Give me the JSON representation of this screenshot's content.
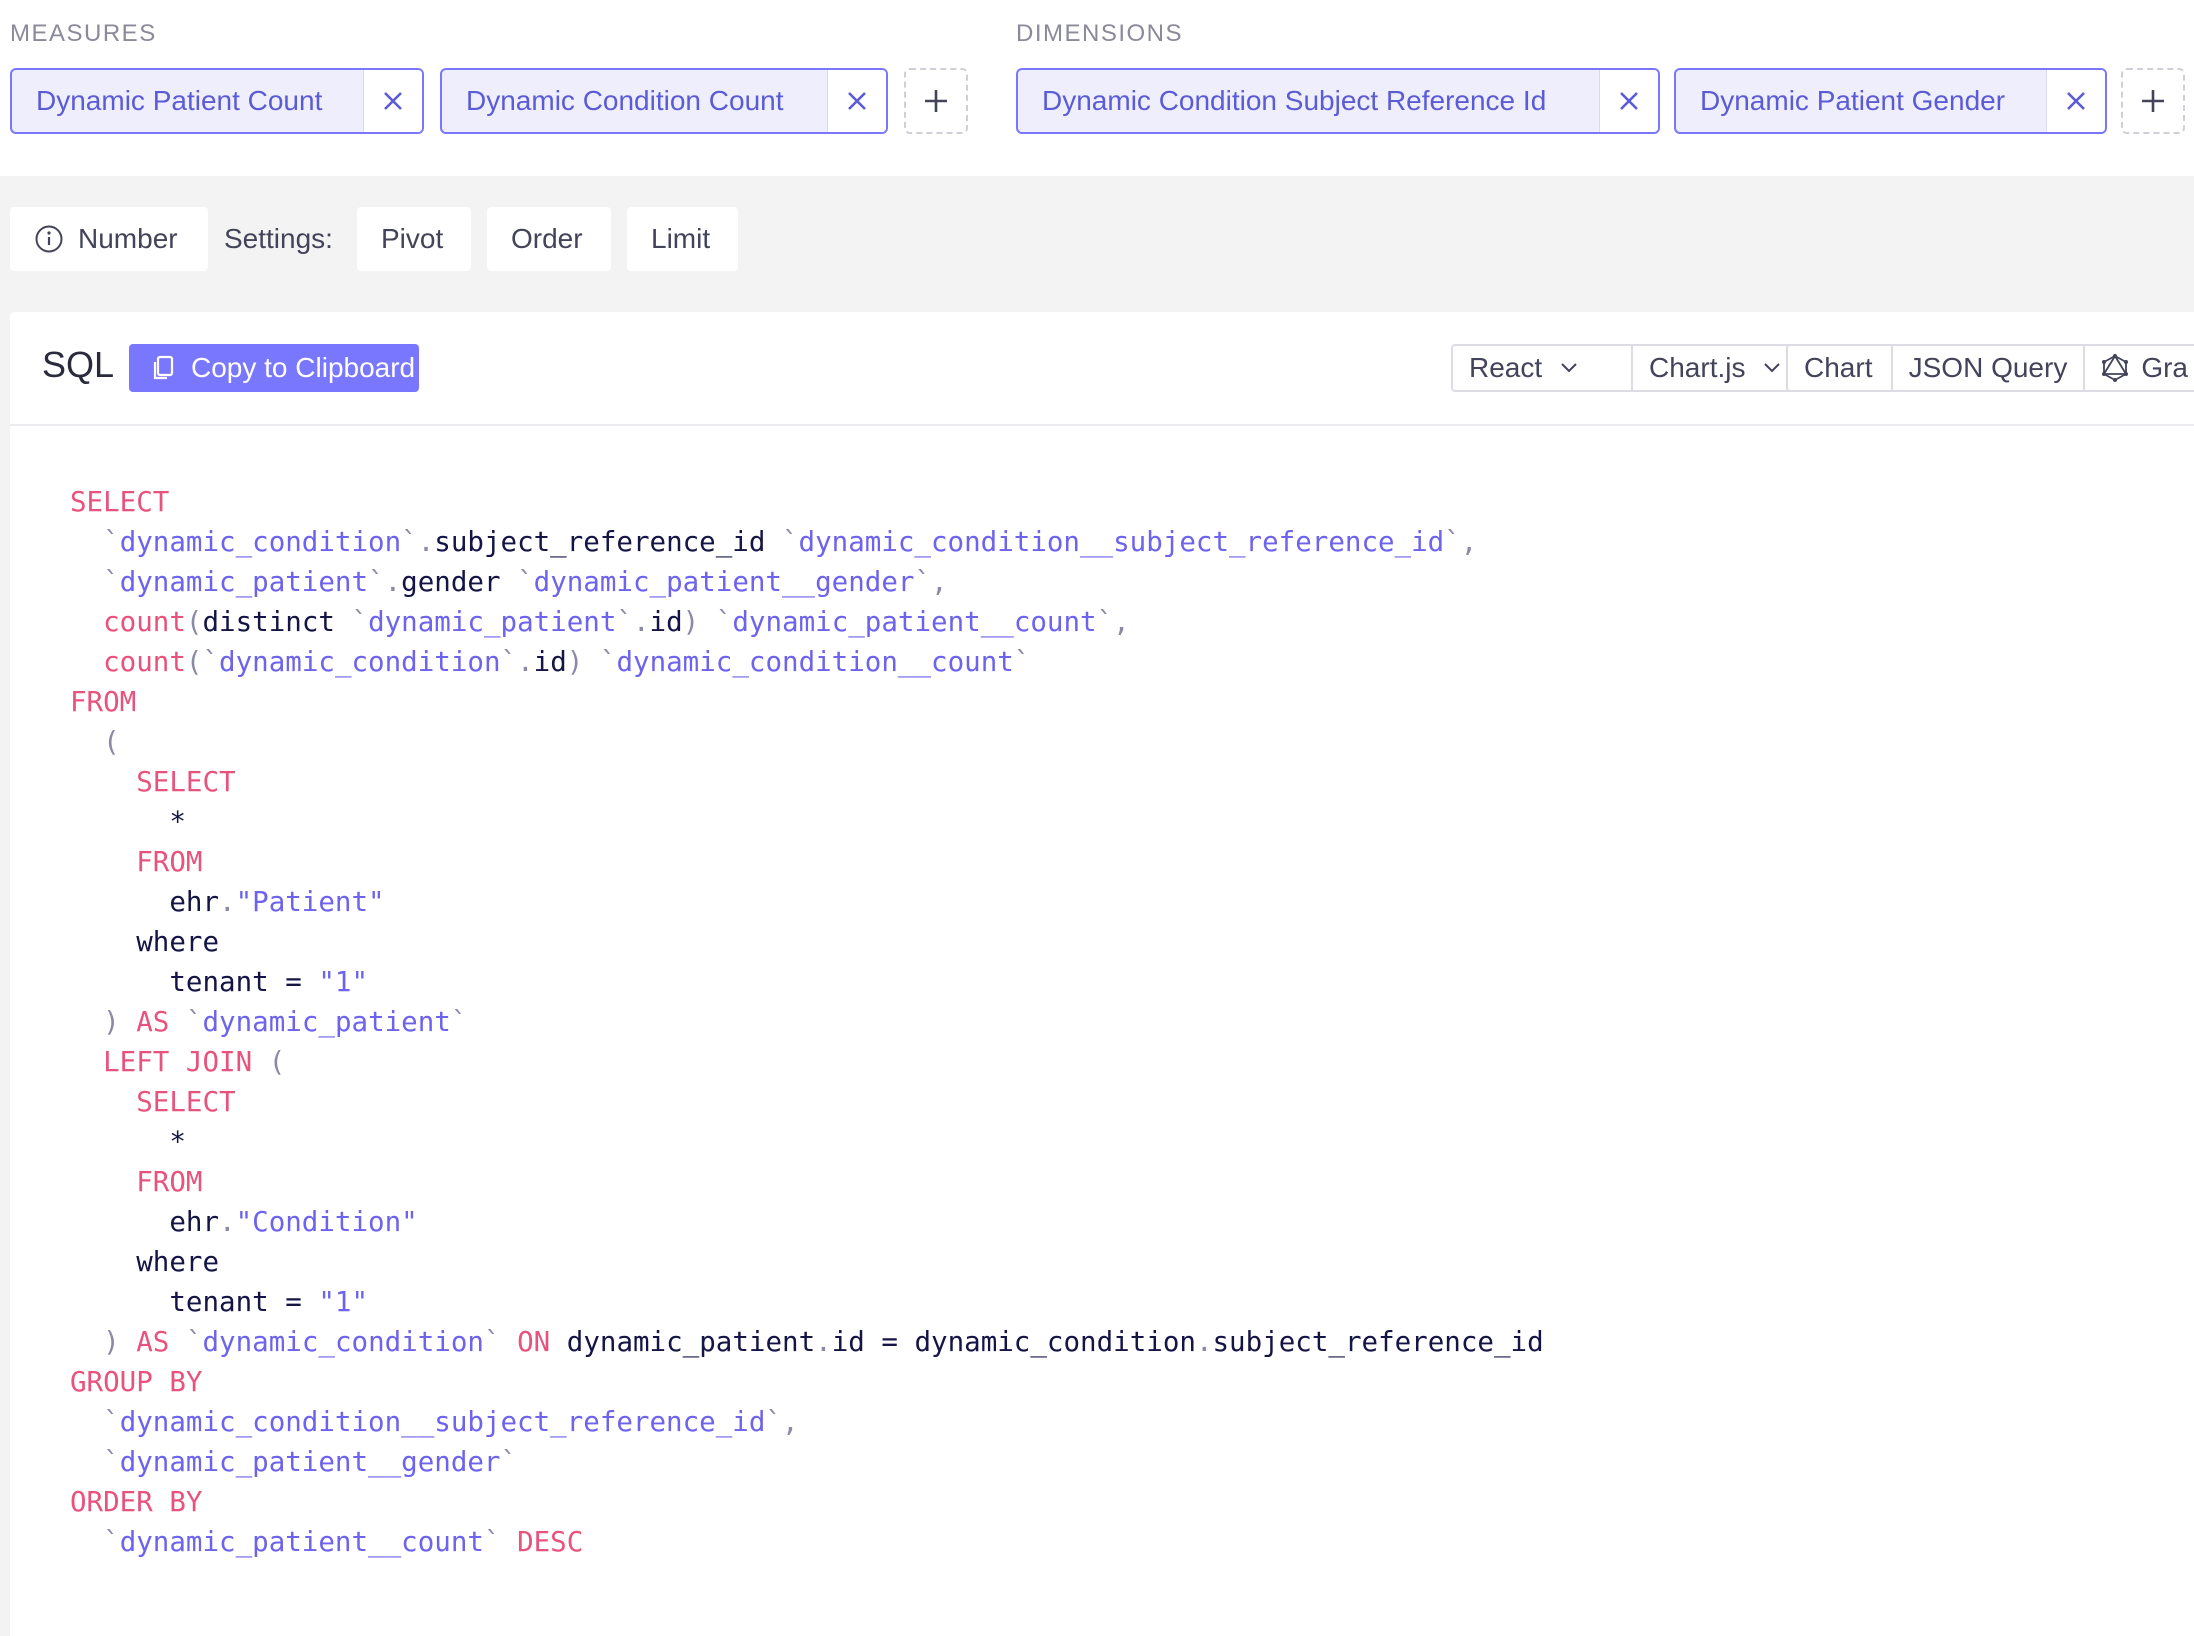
{
  "measures": {
    "label": "MEASURES",
    "items": [
      {
        "label": "Dynamic Patient Count"
      },
      {
        "label": "Dynamic Condition Count"
      }
    ]
  },
  "dimensions": {
    "label": "DIMENSIONS",
    "items": [
      {
        "label": "Dynamic Condition Subject Reference Id"
      },
      {
        "label": "Dynamic Patient Gender"
      }
    ]
  },
  "settings_bar": {
    "chart_type": "Number",
    "settings_label": "Settings:",
    "pivot": "Pivot",
    "order": "Order",
    "limit": "Limit"
  },
  "sql_panel": {
    "title": "SQL",
    "copy_label": "Copy to Clipboard",
    "framework": "React",
    "library": "Chart.js",
    "tabs": [
      "Chart",
      "JSON Query",
      "Gra"
    ]
  },
  "colors": {
    "accent": "#7a77ff",
    "keyword": "#e8537d",
    "identifier": "#6d63ec"
  },
  "sql": [
    [
      {
        "t": "SELECT",
        "c": "kw"
      }
    ],
    [
      {
        "t": "  "
      },
      {
        "t": "`",
        "c": "punc"
      },
      {
        "t": "dynamic_condition",
        "c": "id"
      },
      {
        "t": "`.",
        "c": "punc"
      },
      {
        "t": "subject_reference_id "
      },
      {
        "t": "`",
        "c": "punc"
      },
      {
        "t": "dynamic_condition__subject_reference_id",
        "c": "id"
      },
      {
        "t": "`,",
        "c": "punc"
      }
    ],
    [
      {
        "t": "  "
      },
      {
        "t": "`",
        "c": "punc"
      },
      {
        "t": "dynamic_patient",
        "c": "id"
      },
      {
        "t": "`.",
        "c": "punc"
      },
      {
        "t": "gender "
      },
      {
        "t": "`",
        "c": "punc"
      },
      {
        "t": "dynamic_patient__gender",
        "c": "id"
      },
      {
        "t": "`,",
        "c": "punc"
      }
    ],
    [
      {
        "t": "  "
      },
      {
        "t": "count",
        "c": "kw"
      },
      {
        "t": "(",
        "c": "punc"
      },
      {
        "t": "distinct "
      },
      {
        "t": "`",
        "c": "punc"
      },
      {
        "t": "dynamic_patient",
        "c": "id"
      },
      {
        "t": "`.",
        "c": "punc"
      },
      {
        "t": "id"
      },
      {
        "t": ")",
        "c": "punc"
      },
      {
        "t": " "
      },
      {
        "t": "`",
        "c": "punc"
      },
      {
        "t": "dynamic_patient__count",
        "c": "id"
      },
      {
        "t": "`,",
        "c": "punc"
      }
    ],
    [
      {
        "t": "  "
      },
      {
        "t": "count",
        "c": "kw"
      },
      {
        "t": "(`",
        "c": "punc"
      },
      {
        "t": "dynamic_condition",
        "c": "id"
      },
      {
        "t": "`.",
        "c": "punc"
      },
      {
        "t": "id"
      },
      {
        "t": ")",
        "c": "punc"
      },
      {
        "t": " "
      },
      {
        "t": "`",
        "c": "punc"
      },
      {
        "t": "dynamic_condition__count",
        "c": "id"
      },
      {
        "t": "`",
        "c": "punc"
      }
    ],
    [
      {
        "t": "FROM",
        "c": "kw"
      }
    ],
    [
      {
        "t": "  "
      },
      {
        "t": "(",
        "c": "punc"
      }
    ],
    [
      {
        "t": "    "
      },
      {
        "t": "SELECT",
        "c": "kw"
      }
    ],
    [
      {
        "t": "      *"
      }
    ],
    [
      {
        "t": "    "
      },
      {
        "t": "FROM",
        "c": "kw"
      }
    ],
    [
      {
        "t": "      ehr"
      },
      {
        "t": ".",
        "c": "punc"
      },
      {
        "t": "\"Patient\"",
        "c": "str"
      }
    ],
    [
      {
        "t": "    where"
      }
    ],
    [
      {
        "t": "      tenant = "
      },
      {
        "t": "\"1\"",
        "c": "str"
      }
    ],
    [
      {
        "t": "  "
      },
      {
        "t": ")",
        "c": "punc"
      },
      {
        "t": " "
      },
      {
        "t": "AS",
        "c": "kw"
      },
      {
        "t": " "
      },
      {
        "t": "`",
        "c": "punc"
      },
      {
        "t": "dynamic_patient",
        "c": "id"
      },
      {
        "t": "`",
        "c": "punc"
      }
    ],
    [
      {
        "t": "  "
      },
      {
        "t": "LEFT JOIN",
        "c": "kw"
      },
      {
        "t": " "
      },
      {
        "t": "(",
        "c": "punc"
      }
    ],
    [
      {
        "t": "    "
      },
      {
        "t": "SELECT",
        "c": "kw"
      }
    ],
    [
      {
        "t": "      *"
      }
    ],
    [
      {
        "t": "    "
      },
      {
        "t": "FROM",
        "c": "kw"
      }
    ],
    [
      {
        "t": "      ehr"
      },
      {
        "t": ".",
        "c": "punc"
      },
      {
        "t": "\"Condition\"",
        "c": "str"
      }
    ],
    [
      {
        "t": "    where"
      }
    ],
    [
      {
        "t": "      tenant = "
      },
      {
        "t": "\"1\"",
        "c": "str"
      }
    ],
    [
      {
        "t": "  "
      },
      {
        "t": ")",
        "c": "punc"
      },
      {
        "t": " "
      },
      {
        "t": "AS",
        "c": "kw"
      },
      {
        "t": " "
      },
      {
        "t": "`",
        "c": "punc"
      },
      {
        "t": "dynamic_condition",
        "c": "id"
      },
      {
        "t": "`",
        "c": "punc"
      },
      {
        "t": " "
      },
      {
        "t": "ON",
        "c": "kw"
      },
      {
        "t": " dynamic_patient"
      },
      {
        "t": ".",
        "c": "punc"
      },
      {
        "t": "id = dynamic_condition"
      },
      {
        "t": ".",
        "c": "punc"
      },
      {
        "t": "subject_reference_id"
      }
    ],
    [
      {
        "t": "GROUP BY",
        "c": "kw"
      }
    ],
    [
      {
        "t": "  "
      },
      {
        "t": "`",
        "c": "punc"
      },
      {
        "t": "dynamic_condition__subject_reference_id",
        "c": "id"
      },
      {
        "t": "`,",
        "c": "punc"
      }
    ],
    [
      {
        "t": "  "
      },
      {
        "t": "`",
        "c": "punc"
      },
      {
        "t": "dynamic_patient__gender",
        "c": "id"
      },
      {
        "t": "`",
        "c": "punc"
      }
    ],
    [
      {
        "t": "ORDER BY",
        "c": "kw"
      }
    ],
    [
      {
        "t": "  "
      },
      {
        "t": "`",
        "c": "punc"
      },
      {
        "t": "dynamic_patient__count",
        "c": "id"
      },
      {
        "t": "`",
        "c": "punc"
      },
      {
        "t": " "
      },
      {
        "t": "DESC",
        "c": "kw"
      }
    ]
  ]
}
